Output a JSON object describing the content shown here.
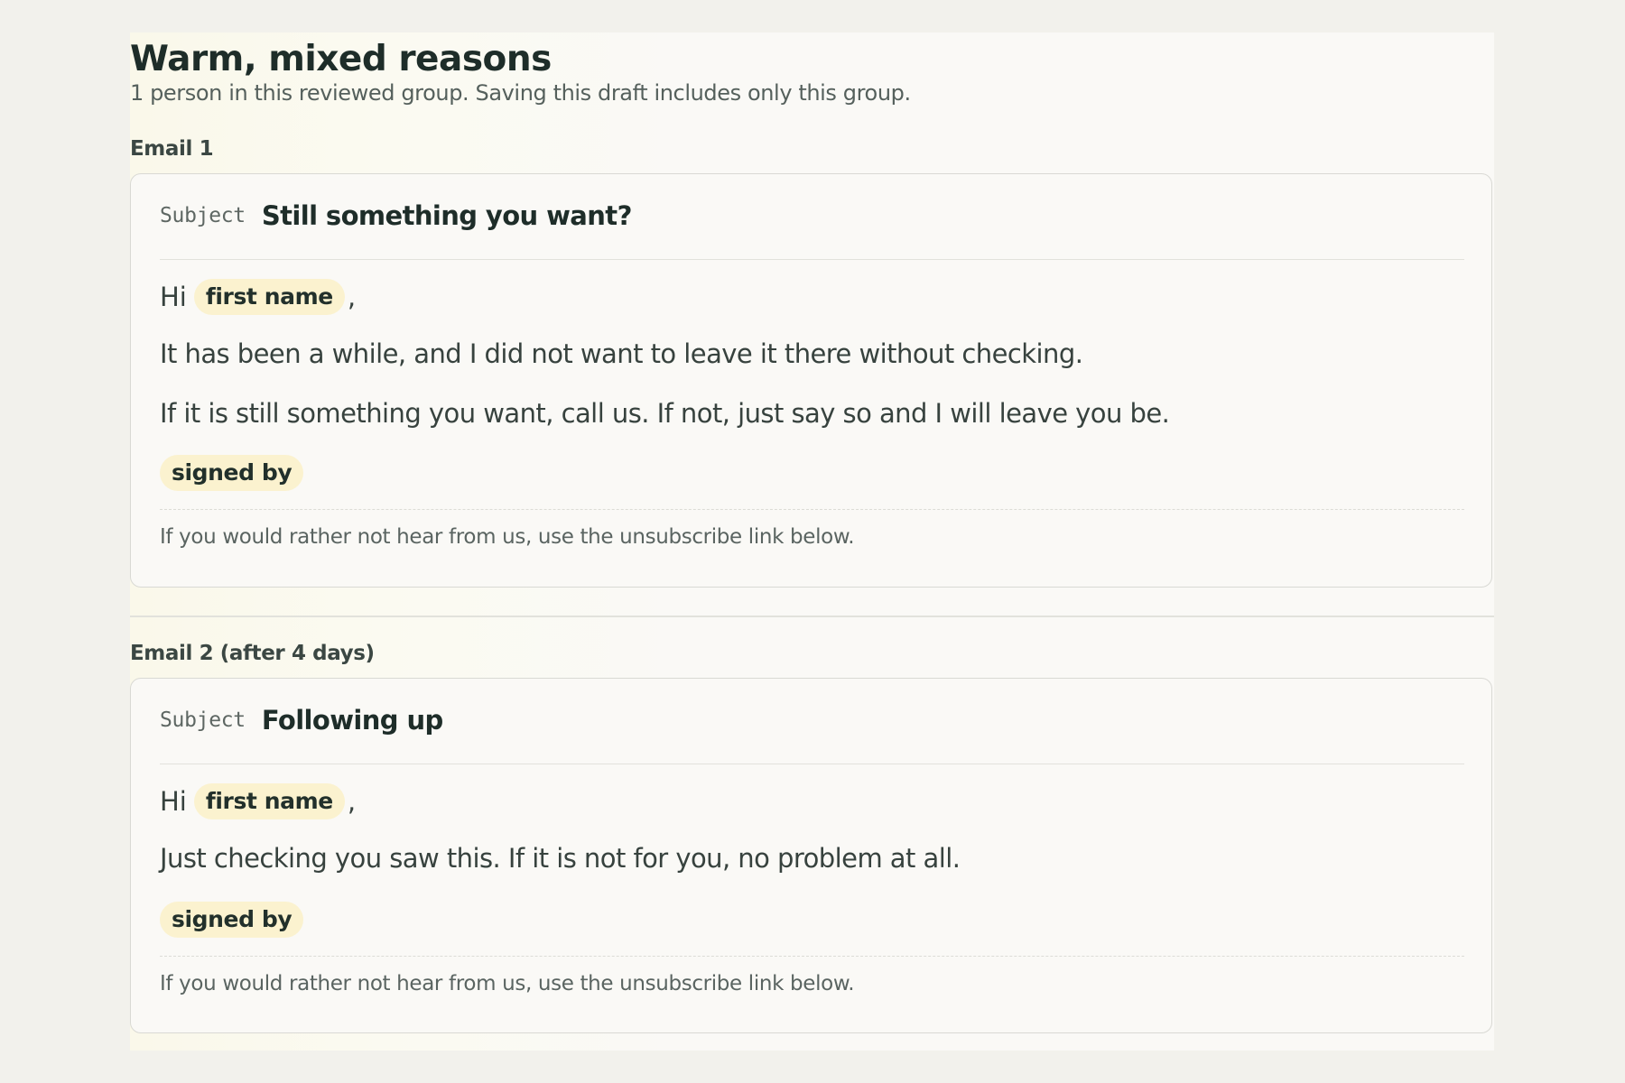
{
  "group": {
    "title": "Warm, mixed reasons",
    "subtitle": "1 person in this reviewed group. Saving this draft includes only this group."
  },
  "emails": [
    {
      "label": "Email 1",
      "subject_label": "Subject",
      "subject": "Still something you want?",
      "greeting": "Hi",
      "first_name_token": "first name",
      "greeting_comma": ",",
      "paragraphs": [
        "It has been a while, and I did not want to leave it there without checking.",
        "If it is still something you want, call us. If not, just say so and I will leave you be."
      ],
      "signed_by_token": "signed by",
      "footer": "If you would rather not hear from us, use the unsubscribe link below."
    },
    {
      "label": "Email 2 (after 4 days)",
      "subject_label": "Subject",
      "subject": "Following up",
      "greeting": "Hi",
      "first_name_token": "first name",
      "greeting_comma": ",",
      "paragraphs": [
        "Just checking you saw this. If it is not for you, no problem at all."
      ],
      "signed_by_token": "signed by",
      "footer": "If you would rather not hear from us, use the unsubscribe link below."
    }
  ],
  "colors": {
    "page_background": "#f2f1ec",
    "card_background": "#faf9f6",
    "token_background": "#fbf2cf",
    "heading_text": "#1e2d29",
    "body_text": "#37423e",
    "card_border": "#d9d9d4"
  }
}
